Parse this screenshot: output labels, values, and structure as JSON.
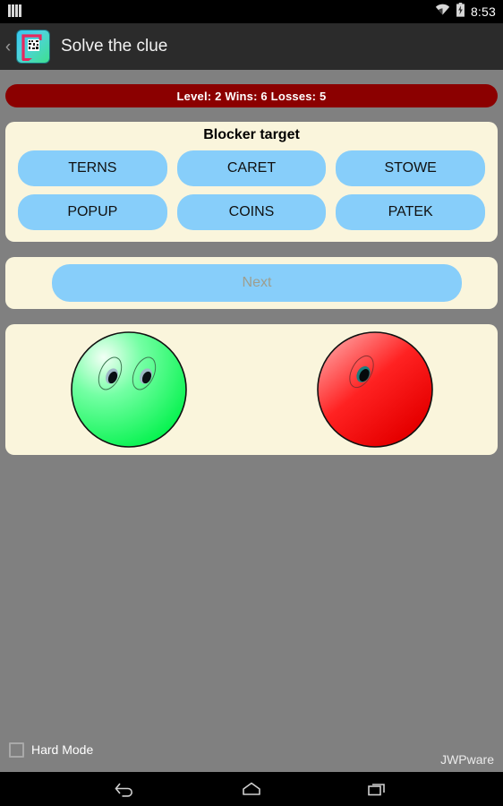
{
  "status_bar": {
    "notification_icon": "bars-icon",
    "wifi_icon": "wifi-icon",
    "battery_icon": "battery-charging-icon",
    "clock": "8:53"
  },
  "app_bar": {
    "back_icon": "back-chevron-icon",
    "app_icon": "hangman-qr-app-icon",
    "title": "Solve the clue"
  },
  "score_bar": {
    "text": "Level: 2 Wins: 6 Losses: 5",
    "background_color": "#8b0000",
    "text_color": "#ffffff"
  },
  "blocker_panel": {
    "title": "Blocker target",
    "words": [
      {
        "label": "TERNS"
      },
      {
        "label": "CARET"
      },
      {
        "label": "STOWE"
      },
      {
        "label": "POPUP"
      },
      {
        "label": "COINS"
      },
      {
        "label": "PATEK"
      }
    ],
    "button_color": "#87cefa",
    "panel_color": "#faf5dc"
  },
  "next_panel": {
    "next_label": "Next",
    "next_enabled": false,
    "next_text_color": "#9e9e8e"
  },
  "faces_panel": {
    "faces": [
      {
        "name": "green-face",
        "color": "#00ff55",
        "eyes": 2
      },
      {
        "name": "red-face",
        "color": "#fa0000",
        "eyes": 1
      }
    ]
  },
  "footer": {
    "hard_mode_label": "Hard Mode",
    "hard_mode_checked": false,
    "brand": "JWPware"
  },
  "nav_bar": {
    "back_icon": "back-arrow-icon",
    "home_icon": "home-icon",
    "recents_icon": "recents-icon"
  }
}
